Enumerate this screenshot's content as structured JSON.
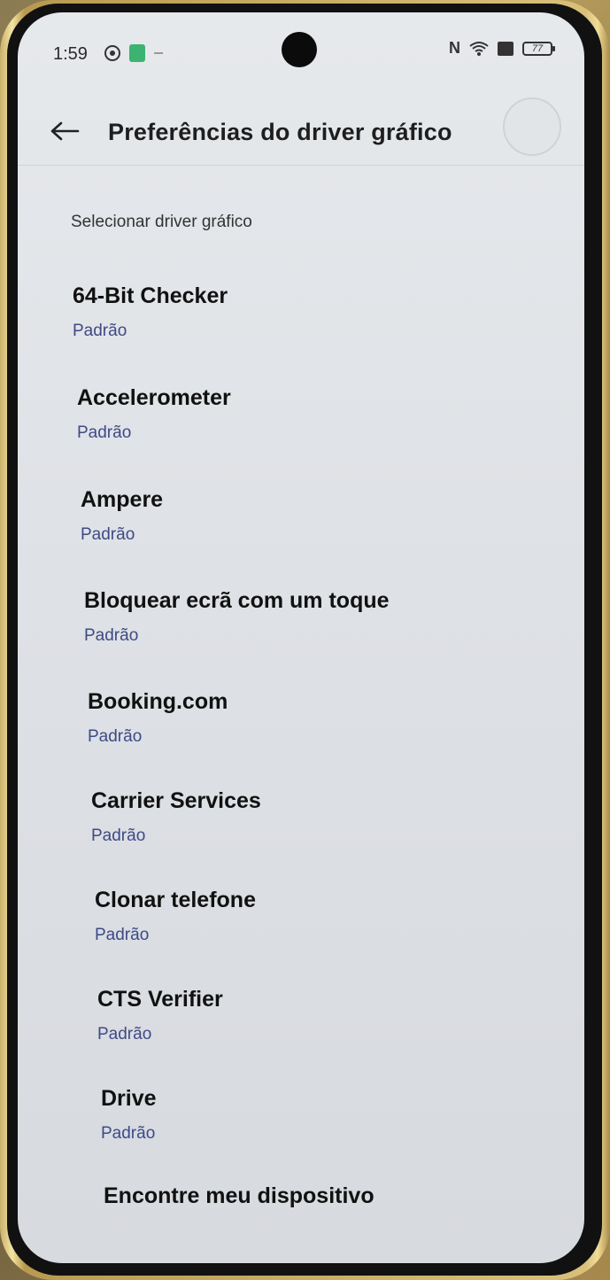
{
  "status_bar": {
    "time": "1:59",
    "battery": "77",
    "icons": [
      "settings-icon",
      "app-notification-icon",
      "nfc-icon",
      "wifi-icon",
      "sim-icon",
      "battery-icon"
    ]
  },
  "header": {
    "title": "Preferências do driver gráfico",
    "back_icon": "arrow-left-icon"
  },
  "section": {
    "title": "Selecionar driver gráfico"
  },
  "apps": [
    {
      "name": "64-Bit Checker",
      "driver": "Padrão"
    },
    {
      "name": "Accelerometer",
      "driver": "Padrão"
    },
    {
      "name": "Ampere",
      "driver": "Padrão"
    },
    {
      "name": "Bloquear ecrã com um toque",
      "driver": "Padrão"
    },
    {
      "name": "Booking.com",
      "driver": "Padrão"
    },
    {
      "name": "Carrier Services",
      "driver": "Padrão"
    },
    {
      "name": "Clonar telefone",
      "driver": "Padrão"
    },
    {
      "name": "CTS Verifier",
      "driver": "Padrão"
    },
    {
      "name": "Drive",
      "driver": "Padrão"
    },
    {
      "name": "Encontre meu dispositivo",
      "driver": ""
    }
  ],
  "colors": {
    "subtitle": "#3e4a86",
    "background": "#e2e5e8"
  }
}
